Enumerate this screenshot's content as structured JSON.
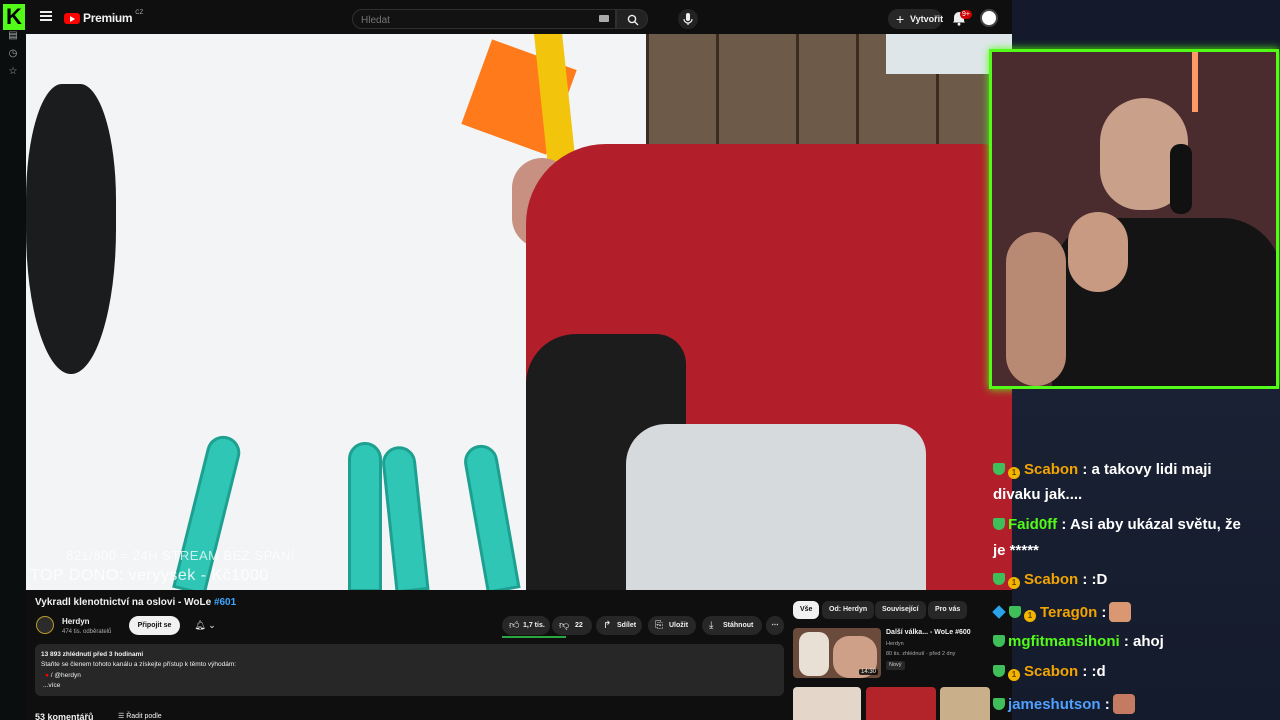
{
  "kick": {
    "logo": "K"
  },
  "header": {
    "brand": "Premium",
    "brand_region": "CZ",
    "search_placeholder": "Hledat",
    "create_label": "Vytvořit",
    "notif_count": "9+"
  },
  "video": {
    "osd_line1": "821/800 = 24H STREAM BEZ SPANÍ",
    "osd_line2": "TOP DONO: veryysek - Kč1000",
    "title_text": "Vykradl klenotnictví na oslovi - WoLe",
    "title_tag": "#601",
    "channel_name": "Herdyn",
    "channel_subs": "474 tis. odběratelů",
    "join_label": "Připojit se",
    "likes": "1,7 tis.",
    "dislikes": "22",
    "share_label": "Sdílet",
    "save_label": "Uložit",
    "download_label": "Stáhnout",
    "more_label": "⋯"
  },
  "description": {
    "stats": "13 893 zhlédnutí  před 3 hodinami",
    "line2": "Staňte se členem tohoto kanálu a získejte přístup k těmto výhodám:",
    "line3": "/ @herdyn",
    "more": "...více"
  },
  "comments": {
    "count_label": "53 komentářů",
    "sort_label": "Řadit podle"
  },
  "chips": [
    "Vše",
    "Od: Herdyn",
    "Související",
    "Pro vás"
  ],
  "recommended": {
    "title": "Další válka... - WoLe #600",
    "channel": "Herdyn",
    "meta": "80 tis. zhlédnutí · před 2 dny",
    "badge": "Nový",
    "duration": "14:30"
  },
  "chat": [
    {
      "user": "Scabon",
      "text": ": a takovy lidi maji"
    },
    {
      "user": "",
      "text": "divaku jak...."
    },
    {
      "user": "Faid0ff",
      "text": ": Asi aby ukázal světu, že"
    },
    {
      "user": "",
      "text": "je *****"
    },
    {
      "user": "Scabon",
      "text": ": :D"
    },
    {
      "user": "Terag0n",
      "text": ":"
    },
    {
      "user": "mgfitmansihoni",
      "text": ": ahoj"
    },
    {
      "user": "Scabon",
      "text": ": :d"
    },
    {
      "user": "jameshutson",
      "text": ":"
    }
  ],
  "colors": {
    "kick_green": "#53fc18",
    "yt_red": "#ff0000",
    "link_blue": "#3ea6ff"
  }
}
